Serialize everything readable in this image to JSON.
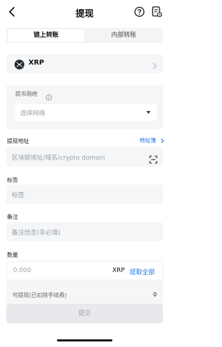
{
  "header": {
    "title": "提现",
    "back_icon": "back-arrow",
    "help_icon": "question-circle",
    "record_icon": "document-history"
  },
  "tabs": [
    {
      "label": "链上转账",
      "active": true
    },
    {
      "label": "内部转账",
      "active": false
    }
  ],
  "coin": {
    "name": "XRP",
    "icon": "xrp-logo"
  },
  "network": {
    "label": "提币网络",
    "placeholder": "选择网络"
  },
  "address": {
    "label": "提现地址",
    "book_link": "地址簿",
    "placeholder": "区块链地址/域名/crypto domain"
  },
  "tag": {
    "label": "标签",
    "placeholder": "标签"
  },
  "memo": {
    "label": "备注",
    "placeholder": "备注信息(非必填)"
  },
  "amount": {
    "label": "数量",
    "placeholder": "0.000",
    "unit": "XRP",
    "all_label": "提取全部",
    "available_label": "可提现(已扣除手续费)",
    "available_value": "0"
  },
  "submit_label": "提交",
  "colors": {
    "accent": "#1a73e8",
    "field_bg": "#f5f6f8",
    "disabled_btn": "#e8e9ec"
  }
}
